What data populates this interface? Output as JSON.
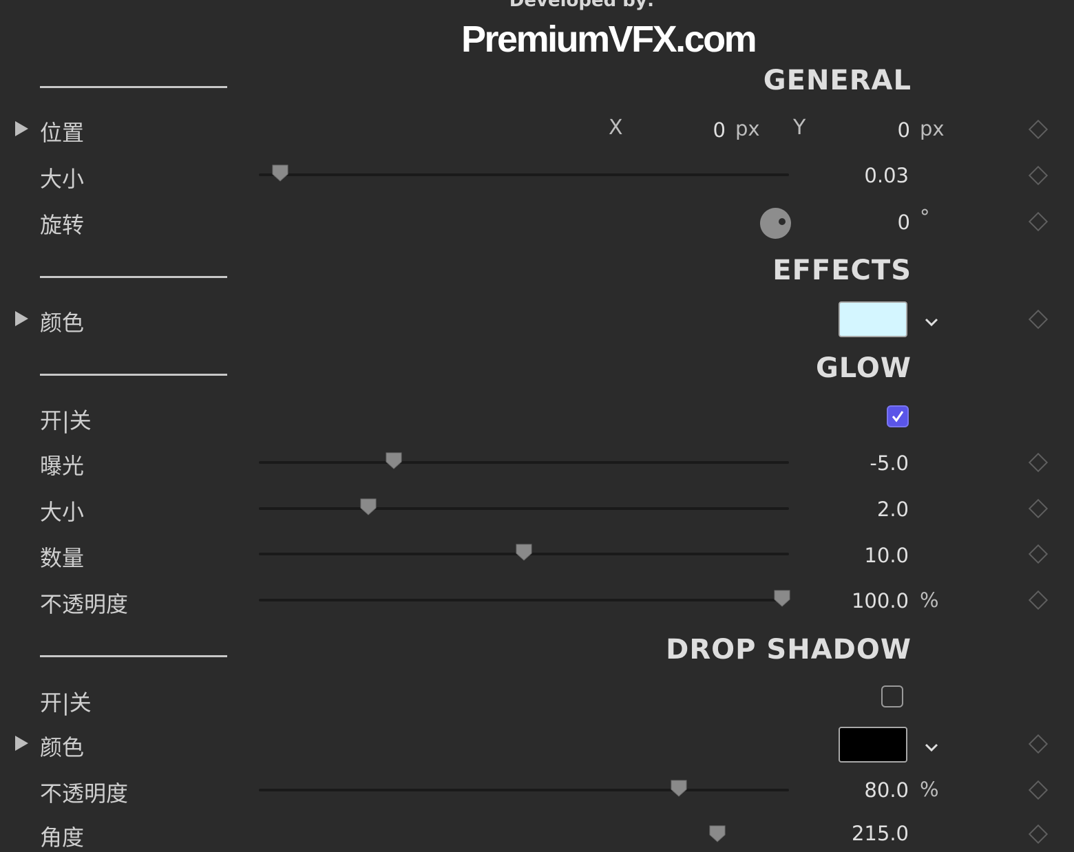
{
  "header": {
    "developed_by": "Developed by:",
    "logo_text": "PremiumVFX.com"
  },
  "colors": {
    "background": "#2b2b2b",
    "glow_color_swatch": "#d4f6ff",
    "shadow_color_swatch": "#000000",
    "checkbox_checked": "#5a55e8"
  },
  "sections": {
    "general": "GENERAL",
    "effects": "EFFECTS",
    "glow": "GLOW",
    "drop_shadow": "DROP SHADOW"
  },
  "general": {
    "position": {
      "label": "位置",
      "x_label": "X",
      "x_value": "0",
      "x_unit": "px",
      "y_label": "Y",
      "y_value": "0",
      "y_unit": "px"
    },
    "size": {
      "label": "大小",
      "value": "0.03",
      "slider_fraction": 0.04
    },
    "rotation": {
      "label": "旋转",
      "value": "0",
      "unit": "°"
    }
  },
  "effects": {
    "color": {
      "label": "颜色"
    }
  },
  "glow": {
    "toggle": {
      "label": "开|关",
      "checked": true
    },
    "exposure": {
      "label": "曝光",
      "value": "-5.0",
      "slider_fraction": 0.255
    },
    "size": {
      "label": "大小",
      "value": "2.0",
      "slider_fraction": 0.207
    },
    "amount": {
      "label": "数量",
      "value": "10.0",
      "slider_fraction": 0.5
    },
    "opacity": {
      "label": "不透明度",
      "value": "100.0",
      "unit": "%",
      "slider_fraction": 0.987
    }
  },
  "drop_shadow": {
    "toggle": {
      "label": "开|关",
      "checked": false
    },
    "color": {
      "label": "颜色"
    },
    "opacity": {
      "label": "不透明度",
      "value": "80.0",
      "unit": "%",
      "slider_fraction": 0.792
    },
    "angle": {
      "label": "角度",
      "value": "215.0",
      "slider_fraction": 0.865
    }
  }
}
